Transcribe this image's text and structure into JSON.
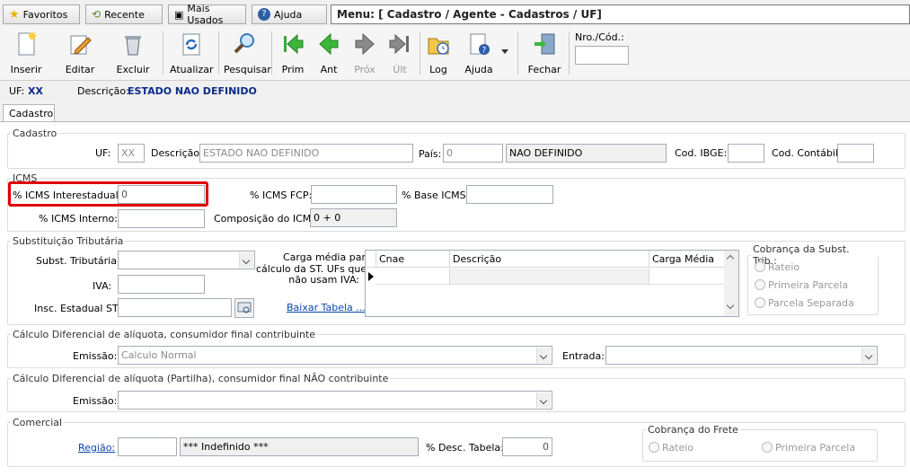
{
  "nav": {
    "favoritos": "Favoritos",
    "recente": "Recente",
    "mais_usados": "Mais Usados",
    "ajuda": "Ajuda",
    "menu_path": "Menu: [ Cadastro / Agente - Cadastros / UF]"
  },
  "toolbar": {
    "inserir": "Inserir",
    "editar": "Editar",
    "excluir": "Excluir",
    "atualizar": "Atualizar",
    "pesquisar": "Pesquisar",
    "prim": "Prim",
    "ant": "Ant",
    "prox": "Próx",
    "ult": "Últ",
    "log": "Log",
    "ajuda": "Ajuda",
    "fechar": "Fechar",
    "nro_cod_label": "Nro./Cód.:",
    "nro_cod_value": ""
  },
  "header": {
    "uf_label": "UF:",
    "uf_value": "XX",
    "descricao_label": "Descrição:",
    "descricao_value": "ESTADO NAO DEFINIDO"
  },
  "tabs": {
    "cadastro": "Cadastro"
  },
  "cadastro": {
    "legend": "Cadastro",
    "uf_label": "UF:",
    "uf_value": "XX",
    "descricao_label": "Descrição:",
    "descricao_value": "ESTADO NAO DEFINIDO",
    "pais_label": "País:",
    "pais_code": "0",
    "pais_name": "NAO DEFINIDO",
    "ibge_label": "Cod. IBGE:",
    "ibge_value": "",
    "contabil_label": "Cod. Contábil:",
    "contabil_value": ""
  },
  "icms": {
    "legend": "ICMS",
    "interestadual_label": "% ICMS Interestadual:",
    "interestadual_value": "0",
    "fcp_label": "% ICMS FCP:",
    "fcp_value": "",
    "base_label": "% Base ICMS:",
    "base_value": "",
    "interno_label": "% ICMS Interno:",
    "interno_value": "",
    "composicao_label": "Composição do ICMS:",
    "composicao_value": "0 + 0"
  },
  "st": {
    "legend": "Substituição Tributária",
    "subst_label": "Subst. Tributária:",
    "subst_value": "",
    "iva_label": "IVA:",
    "iva_value": "",
    "insc_label": "Insc. Estadual ST:",
    "insc_value": "",
    "carga_label_1": "Carga média para",
    "carga_label_2": "cálculo da ST. UFs que",
    "carga_label_3": "não usam IVA:",
    "baixar": "Baixar Tabela ...",
    "grid_cols": [
      "Cnae",
      "Descrição",
      "Carga Média"
    ],
    "cobranca_legend": "Cobrança da Subst. Trib.:",
    "cobranca_options": [
      "Rateio",
      "Primeira Parcela",
      "Parcela Separada"
    ]
  },
  "difal": {
    "legend": "Cálculo Diferencial de alíquota, consumidor final contribuinte",
    "emissao_label": "Emissão:",
    "emissao_value": "Calculo Normal",
    "entrada_label": "Entrada:",
    "entrada_value": ""
  },
  "partilha": {
    "legend": "Cálculo Diferencial de alíquota (Partilha), consumidor final NÃO contribuinte",
    "emissao_label": "Emissão:",
    "emissao_value": ""
  },
  "comercial": {
    "legend": "Comercial",
    "regiao_label": "Região:",
    "regiao_code": "",
    "regiao_name": "*** Indefinido ***",
    "desc_label": "% Desc. Tabela:",
    "desc_value": "0",
    "frete_legend": "Cobrança do Frete",
    "frete_options": [
      "Rateio",
      "Primeira Parcela"
    ]
  }
}
